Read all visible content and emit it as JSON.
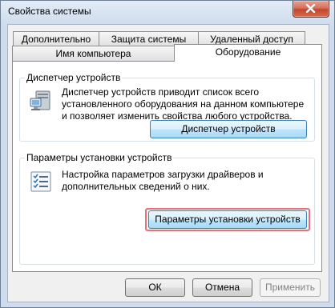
{
  "window": {
    "title": "Свойства системы"
  },
  "tabs": {
    "top_row": [
      "Дополнительно",
      "Защита системы",
      "Удаленный доступ"
    ],
    "bottom_row": [
      "Имя компьютера",
      "Оборудование"
    ],
    "active": "Оборудование"
  },
  "device_manager": {
    "legend": "Диспетчер устройств",
    "description": "Диспетчер устройств приводит список всего установленного оборудования на данном компьютере и позволяет изменить свойства любого устройства.",
    "button": "Диспетчер устройств",
    "icon": "device-manager-icon"
  },
  "install_settings": {
    "legend": "Параметры установки устройств",
    "description": "Настройка параметров загрузки драйверов и дополнительных сведений о них.",
    "button": "Параметры установки устройств",
    "icon": "checklist-icon",
    "highlight_color": "#e8707a"
  },
  "footer": {
    "ok": "ОК",
    "cancel": "Отмена",
    "apply": "Применить"
  }
}
